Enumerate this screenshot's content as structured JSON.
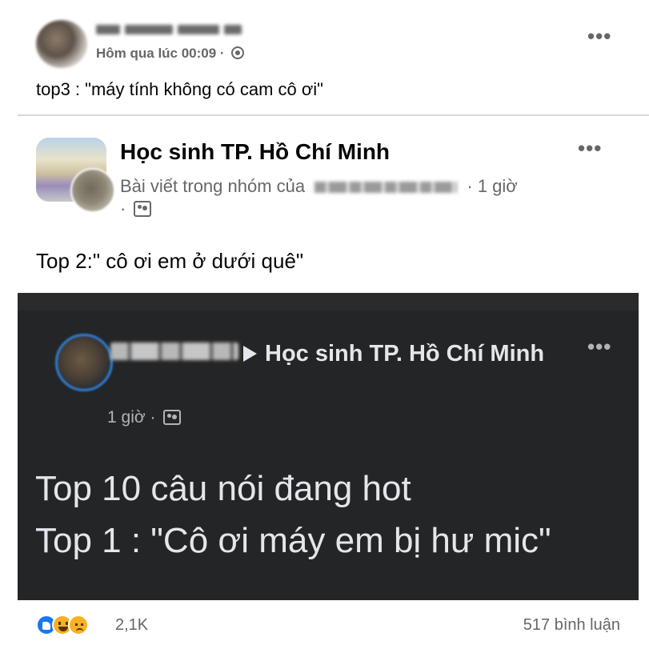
{
  "comment_card": {
    "author_name": "",
    "timestamp": "Hôm qua lúc 00:09 ·",
    "privacy_icon": "friends-icon",
    "text": "top3 : \"máy tính không có cam cô ơi\"",
    "more_label": "•••"
  },
  "group_post": {
    "group_name": "Học sinh TP. Hồ Chí Minh",
    "meta_prefix": "Bài viết trong nhóm của",
    "meta_suffix": "· 1 giờ",
    "meta_line2": "·",
    "text": "Top 2:\" cô ơi em ở dưới quê\"",
    "more_label": "•••"
  },
  "embedded_post": {
    "arrow_target": "Học sinh TP. Hồ Chí Minh",
    "time": "1 giờ ·",
    "more_label": "•••",
    "line1": "Top 10 câu nói đang hot",
    "line2": "Top 1 : \"Cô ơi máy em bị hư mic\""
  },
  "footer": {
    "reactions": [
      "like-icon",
      "haha-icon",
      "sad-icon"
    ],
    "reaction_count": "2,1K",
    "comment_count": "517 bình luận"
  },
  "colors": {
    "text_primary": "#050505",
    "text_secondary": "#65676b",
    "dark_bg": "#242526",
    "dark_text": "#e4e6eb",
    "like_blue": "#1877f2"
  }
}
